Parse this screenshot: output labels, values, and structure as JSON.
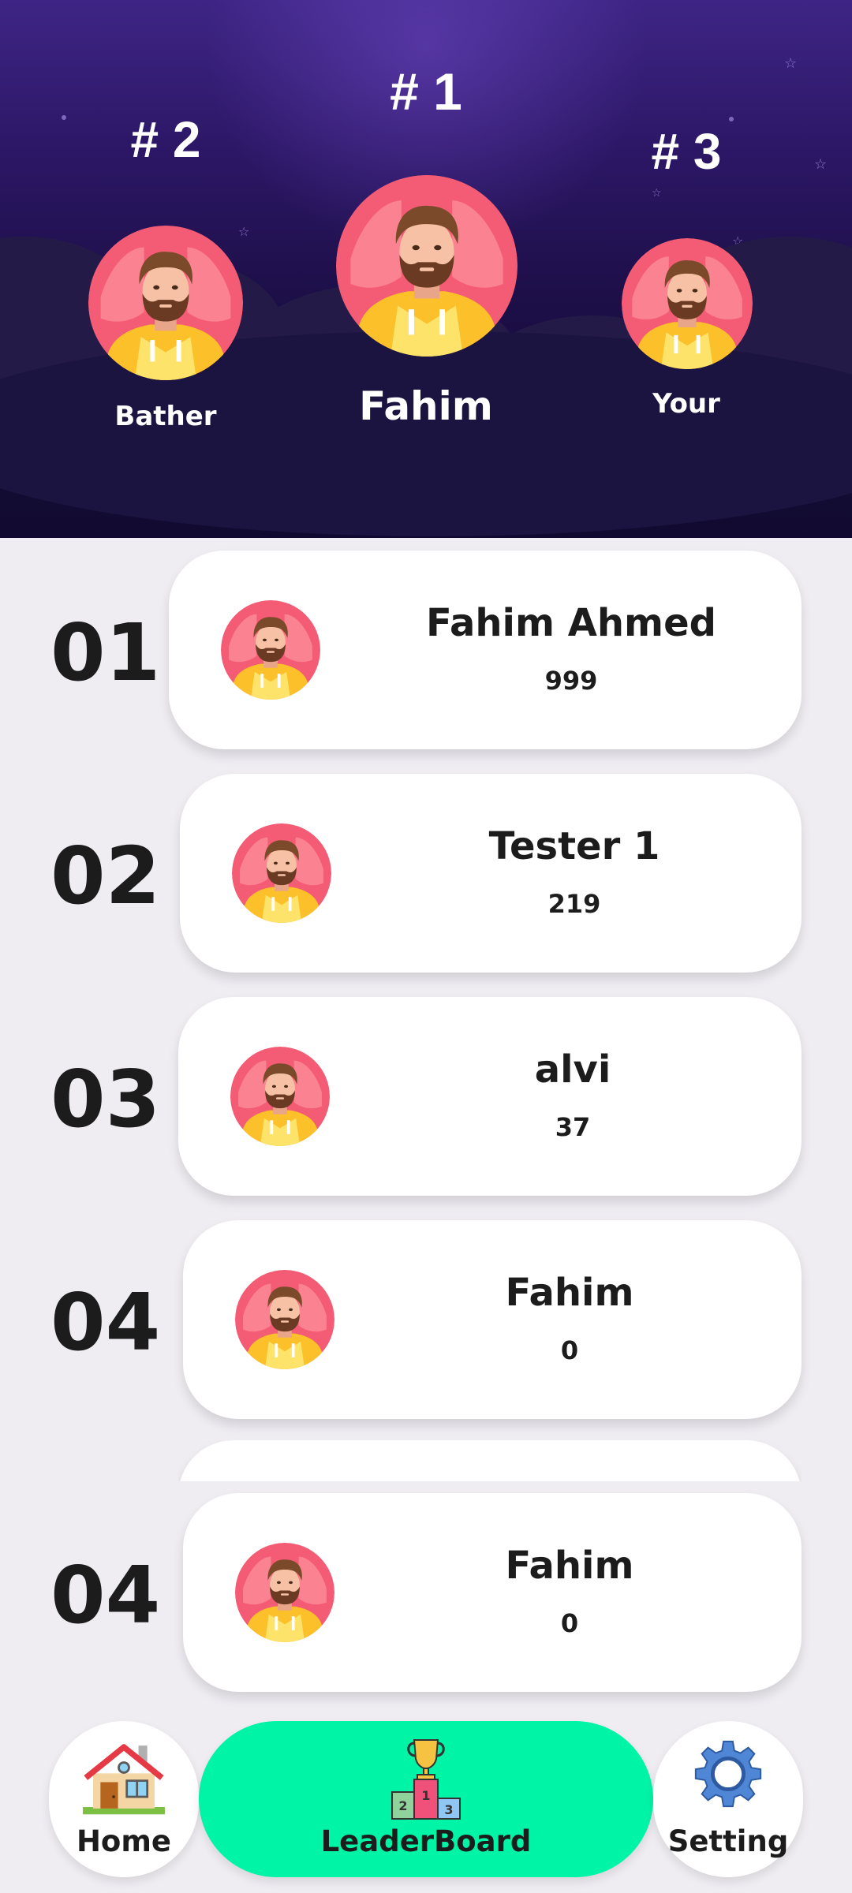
{
  "podium": {
    "first": {
      "rank": "# 1",
      "name": "Fahim"
    },
    "second": {
      "rank": "# 2",
      "name": "Bather"
    },
    "third": {
      "rank": "# 3",
      "name": "Your"
    }
  },
  "leaderboard": [
    {
      "position": "01",
      "name": "Fahim Ahmed",
      "score": "999"
    },
    {
      "position": "02",
      "name": "Tester 1",
      "score": "219"
    },
    {
      "position": "03",
      "name": "alvi",
      "score": "37"
    },
    {
      "position": "04",
      "name": "Fahim",
      "score": "0"
    },
    {
      "position": "04",
      "name": "Fahim",
      "score": "0"
    }
  ],
  "nav": {
    "home": {
      "label": "Home",
      "icon": "house-icon"
    },
    "leaderboard": {
      "label": "LeaderBoard",
      "icon": "trophy-podium-icon"
    },
    "setting": {
      "label": "Setting",
      "icon": "gear-icon"
    }
  },
  "colors": {
    "header_top": "#3e2585",
    "header_bottom": "#0f0830",
    "active_nav": "#00f4a6",
    "avatar_bg": "#f45b74",
    "avatar_hoodie": "#fccb2f"
  }
}
